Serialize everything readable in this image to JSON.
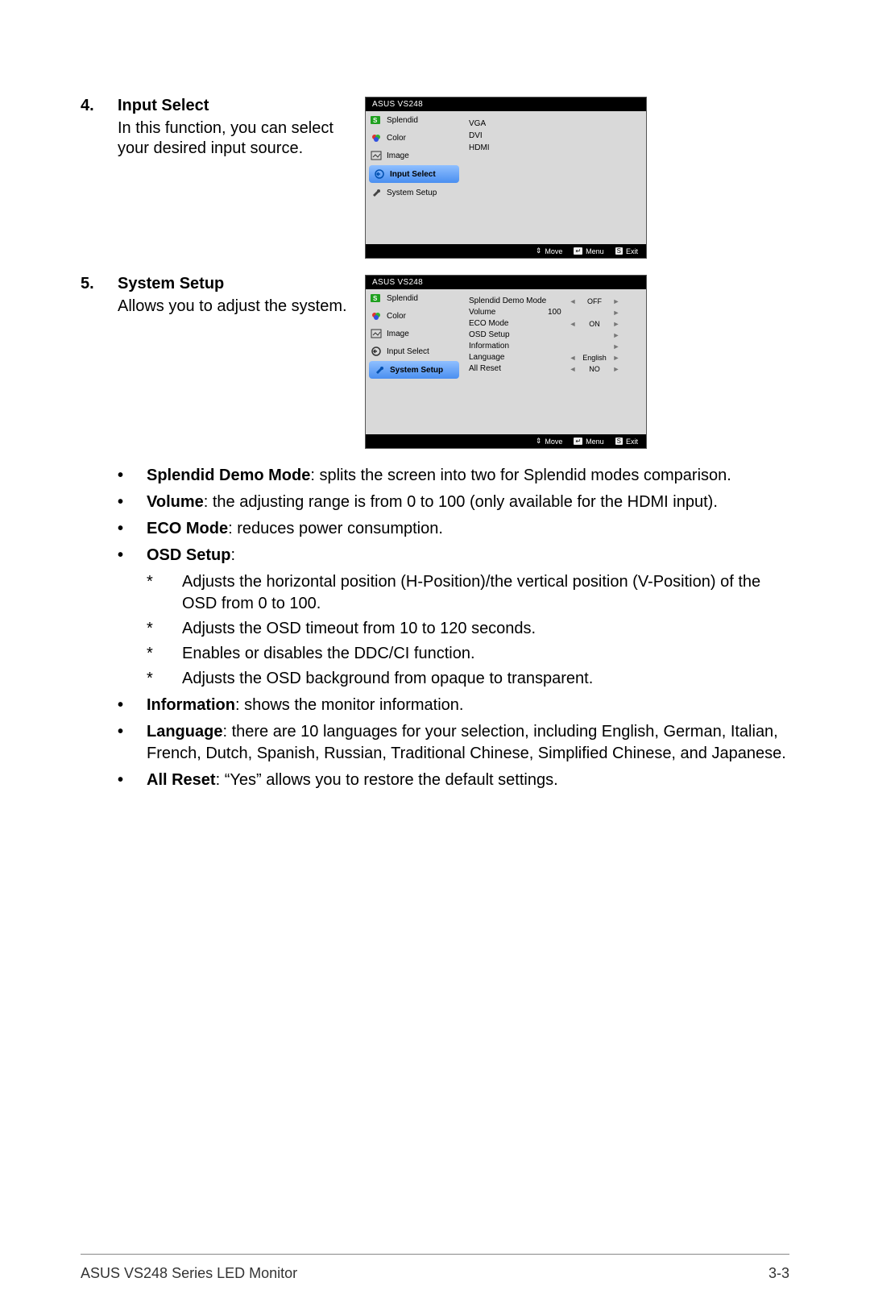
{
  "sections": {
    "s4": {
      "num": "4.",
      "title": "Input Select",
      "desc": "In this function, you can select your desired input source."
    },
    "s5": {
      "num": "5.",
      "title": "System Setup",
      "desc": "Allows you to adjust the system."
    }
  },
  "osd": {
    "title": "ASUS VS248",
    "menu": {
      "splendid": "Splendid",
      "color": "Color",
      "image": "Image",
      "input": "Input Select",
      "system": "System Setup"
    },
    "input_options": [
      "VGA",
      "DVI",
      "HDMI"
    ],
    "system_rows": [
      {
        "label": "Splendid Demo Mode",
        "num": "",
        "value": "OFF",
        "arrows": "lr"
      },
      {
        "label": "Volume",
        "num": "100",
        "value": "",
        "arrows": "r"
      },
      {
        "label": "ECO Mode",
        "num": "",
        "value": "ON",
        "arrows": "lr"
      },
      {
        "label": "OSD Setup",
        "num": "",
        "value": "",
        "arrows": "r"
      },
      {
        "label": "Information",
        "num": "",
        "value": "",
        "arrows": "r"
      },
      {
        "label": "Language",
        "num": "",
        "value": "English",
        "arrows": "lr"
      },
      {
        "label": "All Reset",
        "num": "",
        "value": "NO",
        "arrows": "lr"
      }
    ],
    "footer": {
      "move": "Move",
      "menu": "Menu",
      "exit": "Exit",
      "menu_key": "↵",
      "exit_key": "S"
    }
  },
  "bullets": {
    "splendid_demo_t": "Splendid Demo Mode",
    "splendid_demo_d": ": splits the screen into two for Splendid modes comparison.",
    "volume_t": "Volume",
    "volume_d": ": the adjusting range is from 0 to 100 (only available for the HDMI input).",
    "eco_t": "ECO Mode",
    "eco_d": ": reduces power consumption.",
    "osd_t": "OSD Setup",
    "osd_d": ":",
    "osd_s1": "Adjusts the horizontal position (H-Position)/the vertical position (V-Position) of the OSD from 0 to 100.",
    "osd_s2": "Adjusts the OSD timeout from 10 to 120 seconds.",
    "osd_s3": "Enables or disables the DDC/CI function.",
    "osd_s4": "Adjusts the OSD background from opaque to transparent.",
    "info_t": "Information",
    "info_d": ": shows the monitor information.",
    "lang_t": "Language",
    "lang_d": ": there are 10 languages for your selection, including English, German, Italian, French, Dutch, Spanish, Russian, Traditional Chinese, Simplified Chinese, and Japanese.",
    "reset_t": "All Reset",
    "reset_d": ": “Yes” allows you to restore the default settings."
  },
  "footer": {
    "left": "ASUS VS248 Series LED Monitor",
    "right": "3-3"
  }
}
